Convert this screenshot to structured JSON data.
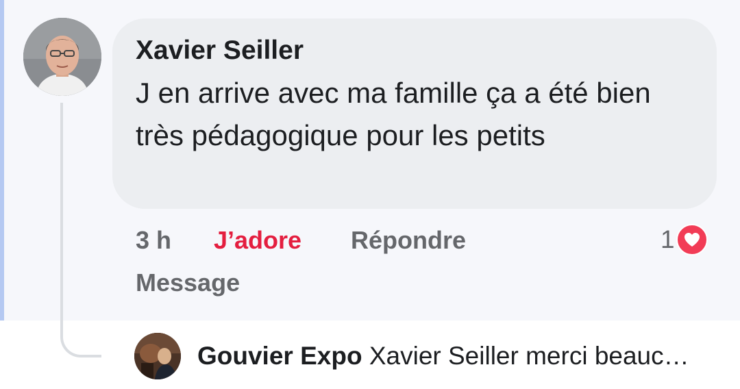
{
  "comment": {
    "author": "Xavier Seiller",
    "text": "J en arrive avec ma famille ça a été bien très pédagogique pour les petits",
    "time": "3 h",
    "love_label": "J’adore",
    "reply_label": "Répondre",
    "message_label": "Message",
    "reaction_count": "1",
    "reaction_icon": "heart-icon",
    "love_color": "#e41e3f"
  },
  "reply_preview": {
    "author": "Gouvier Expo",
    "text": "Xavier Seiller merci beauc…"
  }
}
